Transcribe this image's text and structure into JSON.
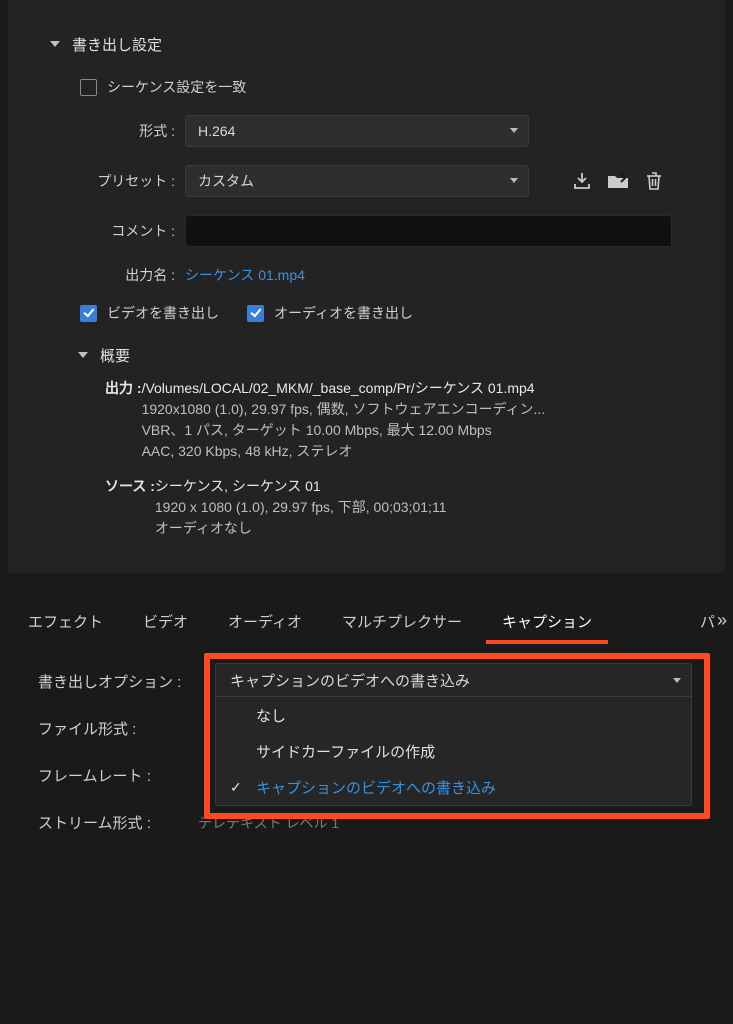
{
  "export": {
    "section_title": "書き出し設定",
    "match_sequence": {
      "label": "シーケンス設定を一致",
      "checked": false
    },
    "format": {
      "label": "形式",
      "value": "H.264"
    },
    "preset": {
      "label": "プリセット",
      "value": "カスタム"
    },
    "comment": {
      "label": "コメント",
      "value": ""
    },
    "output_name": {
      "label": "出力名",
      "value": "シーケンス 01.mp4"
    },
    "export_video": {
      "label": "ビデオを書き出し",
      "checked": true
    },
    "export_audio": {
      "label": "オーディオを書き出し",
      "checked": true
    },
    "summary": {
      "title": "概要",
      "output": {
        "label": "出力",
        "path": "/Volumes/LOCAL/02_MKM/_base_comp/Pr/シーケンス 01.mp4",
        "line2": "1920x1080 (1.0), 29.97 fps, 偶数, ソフトウェアエンコーディン...",
        "line3": "VBR、1 パス, ターゲット 10.00 Mbps, 最大 12.00 Mbps",
        "line4": "AAC, 320 Kbps, 48 kHz, ステレオ"
      },
      "source": {
        "label": "ソース",
        "line1": "シーケンス, シーケンス 01",
        "line2": "1920 x 1080 (1.0), 29.97 fps, 下部, 00;03;01;11",
        "line3": "オーディオなし"
      }
    }
  },
  "tabs": {
    "items": [
      "エフェクト",
      "ビデオ",
      "オーディオ",
      "マルチプレクサー",
      "キャプション"
    ],
    "active_index": 4,
    "overflow": "パ"
  },
  "caption": {
    "export_option": {
      "label": "書き出しオプション",
      "value": "キャプションのビデオへの書き込み"
    },
    "file_format": {
      "label": "ファイル形式"
    },
    "frame_rate": {
      "label": "フレームレート"
    },
    "stream_format": {
      "label": "ストリーム形式",
      "value": "テレテキスト レベル 1"
    },
    "dropdown": {
      "header": "キャプションのビデオへの書き込み",
      "items": [
        {
          "label": "なし",
          "selected": false
        },
        {
          "label": "サイドカーファイルの作成",
          "selected": false
        },
        {
          "label": "キャプションのビデオへの書き込み",
          "selected": true
        }
      ]
    }
  },
  "icons": {
    "save_preset": "save-preset-icon",
    "import_preset": "import-preset-icon",
    "delete_preset": "trash-icon"
  }
}
